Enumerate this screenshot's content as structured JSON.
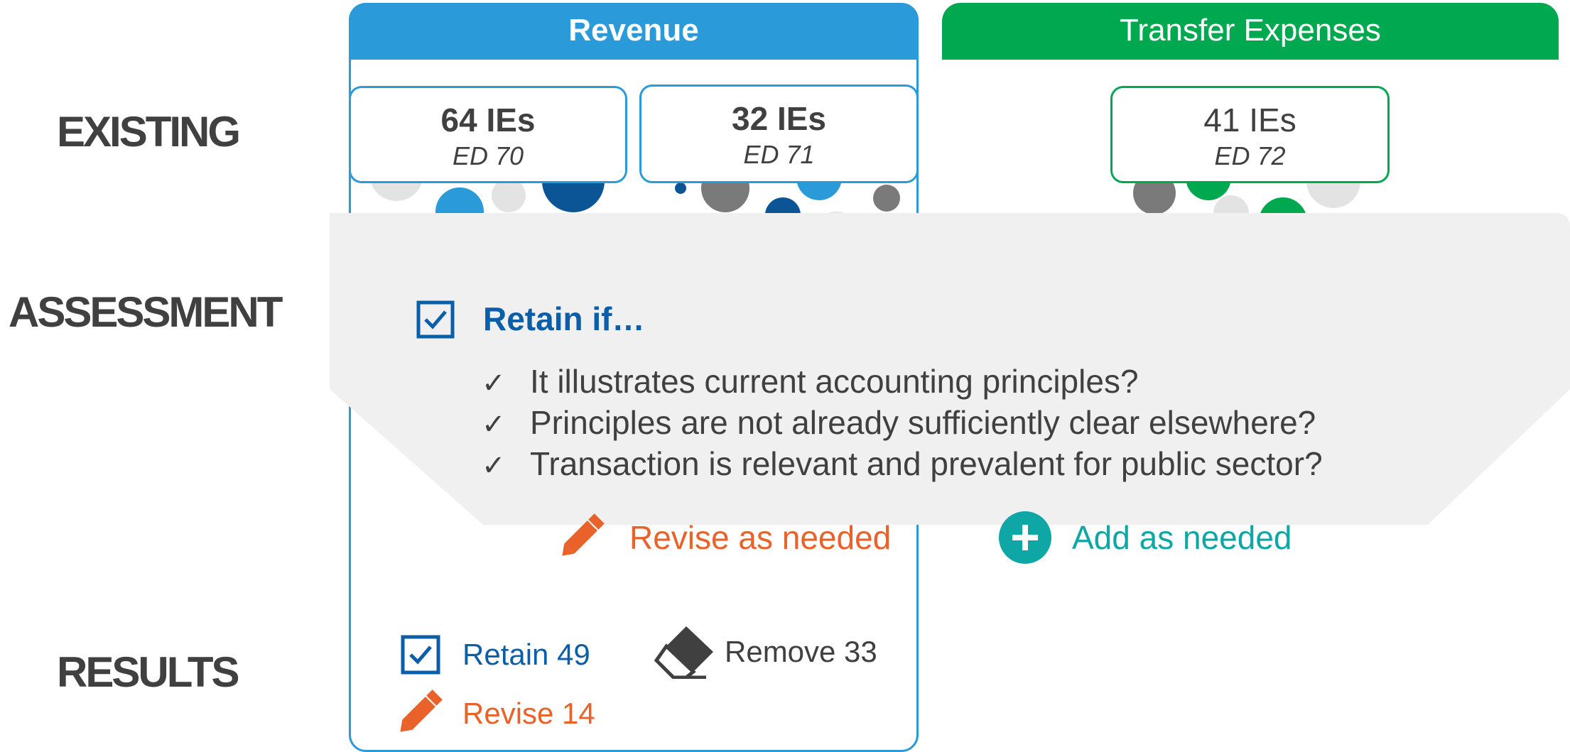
{
  "row_labels": {
    "existing": "EXISTING",
    "assessment": "ASSESSMENT",
    "results": "RESULTS"
  },
  "columns": {
    "revenue": {
      "title": "Revenue",
      "color": "#2b9ad9"
    },
    "transfer_expenses": {
      "title": "Transfer Expenses",
      "color": "#00a94f"
    }
  },
  "ie_boxes": [
    {
      "count": "64 IEs",
      "ed": "ED 70"
    },
    {
      "count": "32 IEs",
      "ed": "ED 71"
    },
    {
      "count": "41 IEs",
      "ed": "ED 72"
    }
  ],
  "assessment": {
    "title": "Retain if…",
    "criteria": [
      "It illustrates current accounting principles?",
      "Principles are not already sufficiently clear elsewhere?",
      "Transaction is relevant and prevalent for public sector?"
    ],
    "tick_glyph": "✓",
    "banner_color": "#f0f0f0"
  },
  "actions": {
    "revise": "Revise as needed",
    "add": "Add as needed",
    "revise_color": "#e8622a",
    "add_color": "#0fa6a6"
  },
  "results": {
    "retain": "Retain 49",
    "remove": "Remove 33",
    "revise": "Revise 14"
  },
  "icons": [
    "checkbox-icon",
    "pencil-icon",
    "plus-circle-icon",
    "eraser-icon",
    "check-mark-icon"
  ]
}
